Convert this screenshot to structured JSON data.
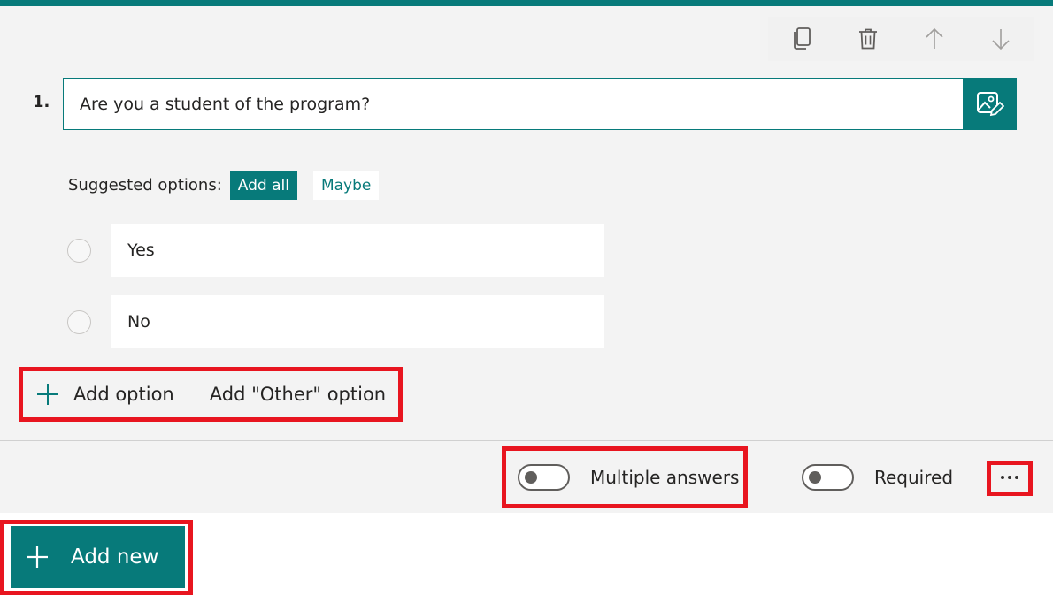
{
  "theme": {
    "accent": "#077a7a",
    "highlight": "#e8151f",
    "background": "#f3f3f3"
  },
  "toolbar": {
    "items": [
      {
        "icon": "copy-icon"
      },
      {
        "icon": "trash-icon"
      },
      {
        "icon": "arrow-up-icon"
      },
      {
        "icon": "arrow-down-icon"
      }
    ]
  },
  "question": {
    "number": "1.",
    "text": "Are you a student of the program?",
    "image_button_icon": "image-edit-icon"
  },
  "suggested": {
    "label": "Suggested options:",
    "add_all": "Add all",
    "chips": [
      "Maybe"
    ]
  },
  "options": [
    "Yes",
    "No"
  ],
  "add_options": {
    "add_option": "Add option",
    "add_other": "Add \"Other\" option"
  },
  "settings": {
    "multiple_answers": {
      "label": "Multiple answers",
      "on": false
    },
    "required": {
      "label": "Required",
      "on": false
    },
    "more_icon": "ellipsis-icon"
  },
  "add_new": {
    "label": "Add new",
    "icon": "plus-icon"
  }
}
